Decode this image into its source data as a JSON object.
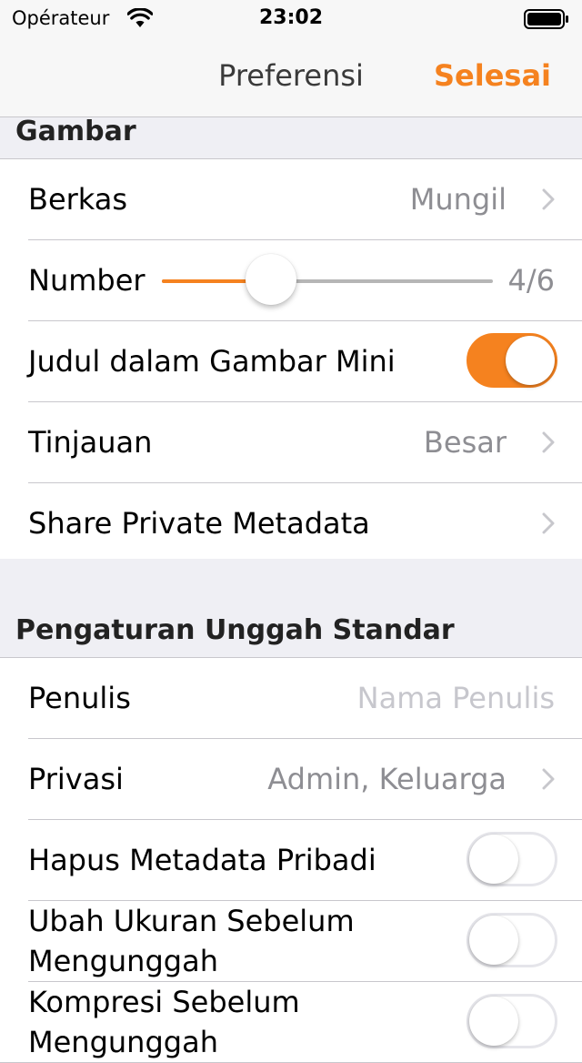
{
  "status_bar": {
    "carrier": "Opérateur",
    "time": "23:02",
    "wifi_icon": "wifi-icon",
    "battery_icon": "battery-icon"
  },
  "nav": {
    "title": "Preferensi",
    "done_label": "Selesai"
  },
  "colors": {
    "accent": "#f5821f",
    "background": "#efeff4",
    "secondary_text": "#8e8e93",
    "placeholder_text": "#c7c7cd"
  },
  "sections": [
    {
      "title": "Gambar",
      "rows": [
        {
          "label": "Berkas",
          "value": "Mungil",
          "type": "disclosure"
        },
        {
          "label": "Number",
          "value": "4/6",
          "type": "slider",
          "level": 0.33
        },
        {
          "label": "Judul dalam Gambar Mini",
          "type": "toggle",
          "on": true
        },
        {
          "label": "Tinjauan",
          "value": "Besar",
          "type": "disclosure"
        },
        {
          "label": "Share Private Metadata",
          "type": "disclosure"
        }
      ]
    },
    {
      "title": "Pengaturan Unggah Standar",
      "rows": [
        {
          "label": "Penulis",
          "placeholder": "Nama Penulis",
          "type": "text-input"
        },
        {
          "label": "Privasi",
          "value": "Admin, Keluarga",
          "type": "disclosure"
        },
        {
          "label": "Hapus Metadata Pribadi",
          "type": "toggle",
          "on": false
        },
        {
          "label": "Ubah Ukuran Sebelum Mengunggah",
          "type": "toggle",
          "on": false
        },
        {
          "label": "Kompresi Sebelum Mengunggah",
          "type": "toggle",
          "on": false
        }
      ]
    }
  ]
}
